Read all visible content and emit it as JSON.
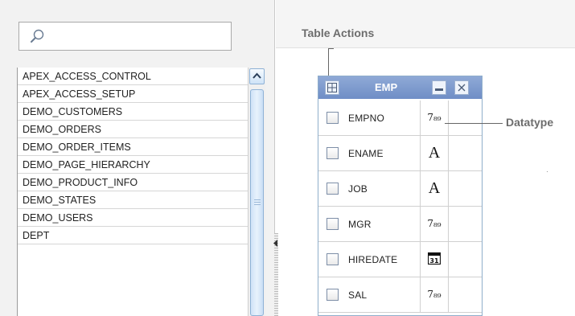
{
  "search": {
    "value": "",
    "icon": "search-icon"
  },
  "table_list": [
    "APEX_ACCESS_CONTROL",
    "APEX_ACCESS_SETUP",
    "DEMO_CUSTOMERS",
    "DEMO_ORDERS",
    "DEMO_ORDER_ITEMS",
    "DEMO_PAGE_HIERARCHY",
    "DEMO_PRODUCT_INFO",
    "DEMO_STATES",
    "DEMO_USERS",
    "DEPT"
  ],
  "right": {
    "header_label": "Table Actions"
  },
  "emp_table": {
    "title": "EMP",
    "columns": [
      {
        "name": "EMPNO",
        "type_icon": "number-type-icon",
        "type_text": "7₈₉"
      },
      {
        "name": "ENAME",
        "type_icon": "text-type-icon",
        "type_text": "A"
      },
      {
        "name": "JOB",
        "type_icon": "text-type-icon",
        "type_text": "A"
      },
      {
        "name": "MGR",
        "type_icon": "number-type-icon",
        "type_text": "7₈₉"
      },
      {
        "name": "HIREDATE",
        "type_icon": "calendar-type-icon",
        "type_text": "31"
      },
      {
        "name": "SAL",
        "type_icon": "number-type-icon",
        "type_text": "7₈₉"
      }
    ]
  },
  "callouts": {
    "datatype_label": "Datatype"
  },
  "colors": {
    "titlebar": "#7f9bcd",
    "scrollbar": "#cfe2f7",
    "label_gray": "#6d6d6d"
  }
}
